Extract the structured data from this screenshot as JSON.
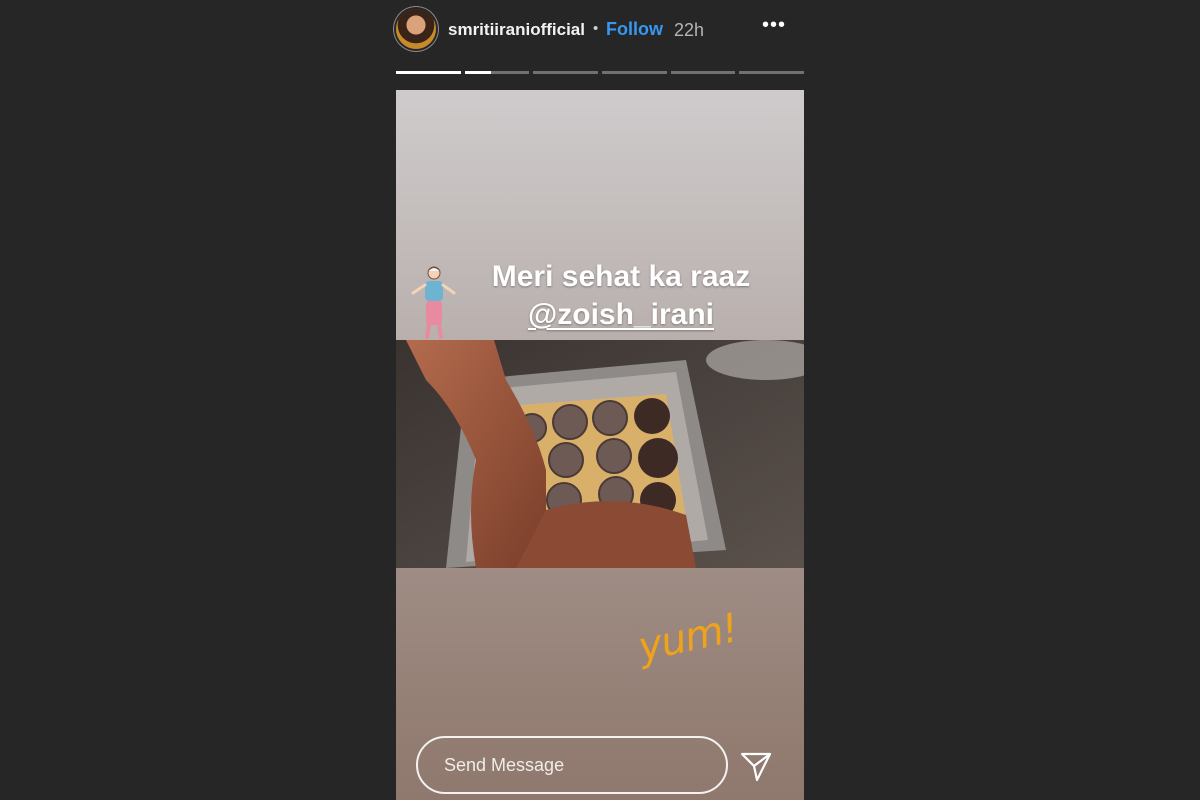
{
  "header": {
    "avatar_icon": "profile-avatar",
    "username": "smritiiraniofficial",
    "separator": "•",
    "follow_label": "Follow",
    "time_ago": "22h",
    "more_icon": "more-options-icon",
    "more_glyph": "•••"
  },
  "progress": {
    "total_segments": 6,
    "current_index": 1,
    "current_fill": 0.4
  },
  "story": {
    "caption_line1": "Meri sehat ka raaz",
    "mention": "@zoish_irani",
    "sticker": "dancing-person-sticker",
    "handwritten": "yum!"
  },
  "reply": {
    "placeholder": "Send Message",
    "send_icon": "paper-plane-send-icon"
  }
}
